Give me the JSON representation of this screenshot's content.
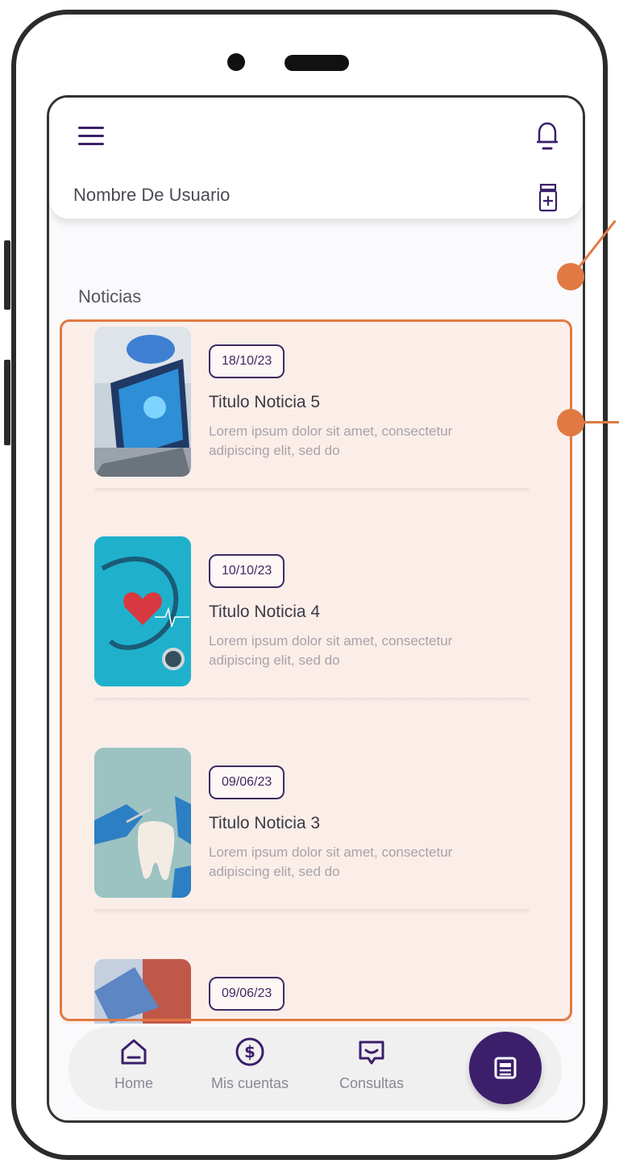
{
  "header": {
    "user_name": "Nombre De Usuario"
  },
  "section": {
    "title": "Noticias"
  },
  "news": [
    {
      "date": "18/10/23",
      "title": "Titulo Noticia 5",
      "desc": "Lorem ipsum dolor sit amet, consectetur adipiscing elit, sed do"
    },
    {
      "date": "10/10/23",
      "title": "Titulo Noticia 4",
      "desc": "Lorem ipsum dolor sit amet, consectetur adipiscing elit, sed do"
    },
    {
      "date": "09/06/23",
      "title": "Titulo Noticia 3",
      "desc": "Lorem ipsum dolor sit amet, consectetur adipiscing elit, sed do"
    },
    {
      "date": "09/06/23"
    }
  ],
  "bottom_nav": {
    "home": "Home",
    "accounts": "Mis cuentas",
    "consults": "Consultas"
  },
  "icons": {
    "menu": "menu-icon",
    "bell": "bell-icon",
    "medicine": "medicine-bottle-icon",
    "home": "home-icon",
    "accounts": "dollar-icon",
    "consults": "chat-icon",
    "news": "newspaper-icon"
  },
  "colors": {
    "primary": "#3b1f6b",
    "accent": "#e07a42",
    "list_bg": "#fbeee9"
  }
}
